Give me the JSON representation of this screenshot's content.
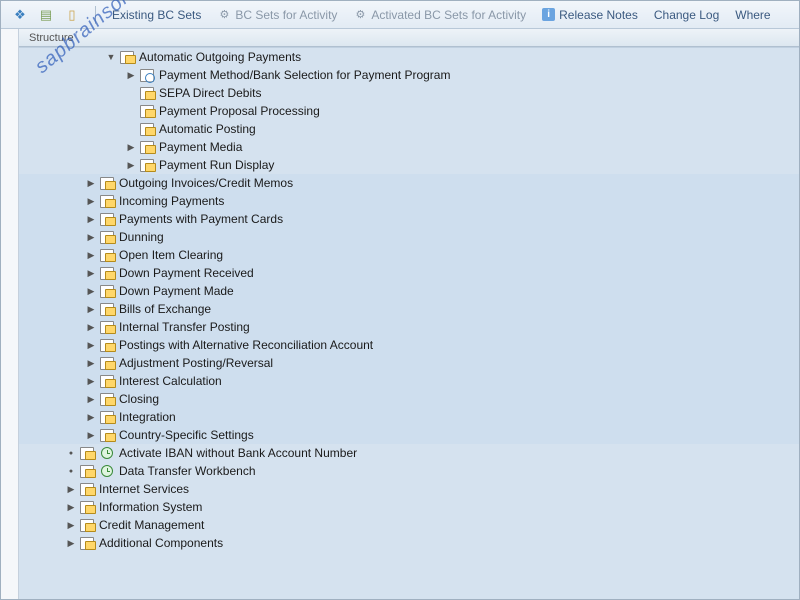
{
  "toolbar": {
    "existing_bc": "Existing BC Sets",
    "bc_activity": "BC Sets for Activity",
    "activated_bc": "Activated BC Sets for Activity",
    "release_notes": "Release Notes",
    "change_log": "Change Log",
    "where": "Where"
  },
  "column_header": "Structure",
  "watermark_text": "sapbrainsonline.com",
  "tree": {
    "auto_outgoing": "Automatic Outgoing Payments",
    "pm_method": "Payment Method/Bank Selection for Payment Program",
    "sepa": "SEPA Direct Debits",
    "proposal": "Payment Proposal Processing",
    "auto_posting": "Automatic Posting",
    "media": "Payment Media",
    "run_display": "Payment Run Display",
    "outgoing_inv": "Outgoing Invoices/Credit Memos",
    "incoming": "Incoming Payments",
    "pay_cards": "Payments with Payment Cards",
    "dunning": "Dunning",
    "open_item": "Open Item Clearing",
    "down_recv": "Down Payment Received",
    "down_made": "Down Payment Made",
    "bills_exch": "Bills of Exchange",
    "int_transfer": "Internal Transfer Posting",
    "alt_recon": "Postings with Alternative Reconciliation Account",
    "adj_reversal": "Adjustment Posting/Reversal",
    "interest": "Interest Calculation",
    "closing": "Closing",
    "integration": "Integration",
    "country": "Country-Specific Settings",
    "iban": "Activate IBAN without Bank Account Number",
    "data_transfer": "Data Transfer Workbench",
    "internet": "Internet Services",
    "info_sys": "Information System",
    "credit_mgmt": "Credit Management",
    "additional": "Additional Components"
  }
}
